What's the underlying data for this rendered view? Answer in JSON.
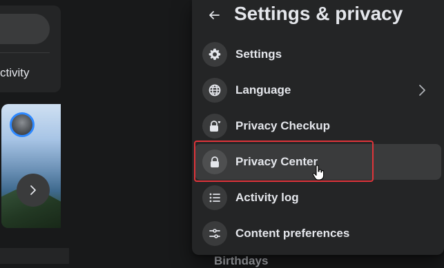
{
  "background": {
    "activity_text": "ctivity",
    "birthdays_text": "Birthdays"
  },
  "panel": {
    "title": "Settings & privacy",
    "back_icon": "arrow-left-icon",
    "items": [
      {
        "label": "Settings",
        "icon": "gear-icon",
        "has_chevron": false
      },
      {
        "label": "Language",
        "icon": "globe-icon",
        "has_chevron": true
      },
      {
        "label": "Privacy Checkup",
        "icon": "lock-heart-icon",
        "has_chevron": false
      },
      {
        "label": "Privacy Center",
        "icon": "lock-icon",
        "has_chevron": false,
        "highlighted": true
      },
      {
        "label": "Activity log",
        "icon": "list-icon",
        "has_chevron": false
      },
      {
        "label": "Content preferences",
        "icon": "sliders-icon",
        "has_chevron": false
      }
    ]
  },
  "colors": {
    "page_bg": "#18191a",
    "panel_bg": "#242526",
    "hover_bg": "#3a3b3c",
    "text": "#e4e6eb",
    "annotation_red": "#e0343a",
    "story_ring": "#2d88ff"
  }
}
